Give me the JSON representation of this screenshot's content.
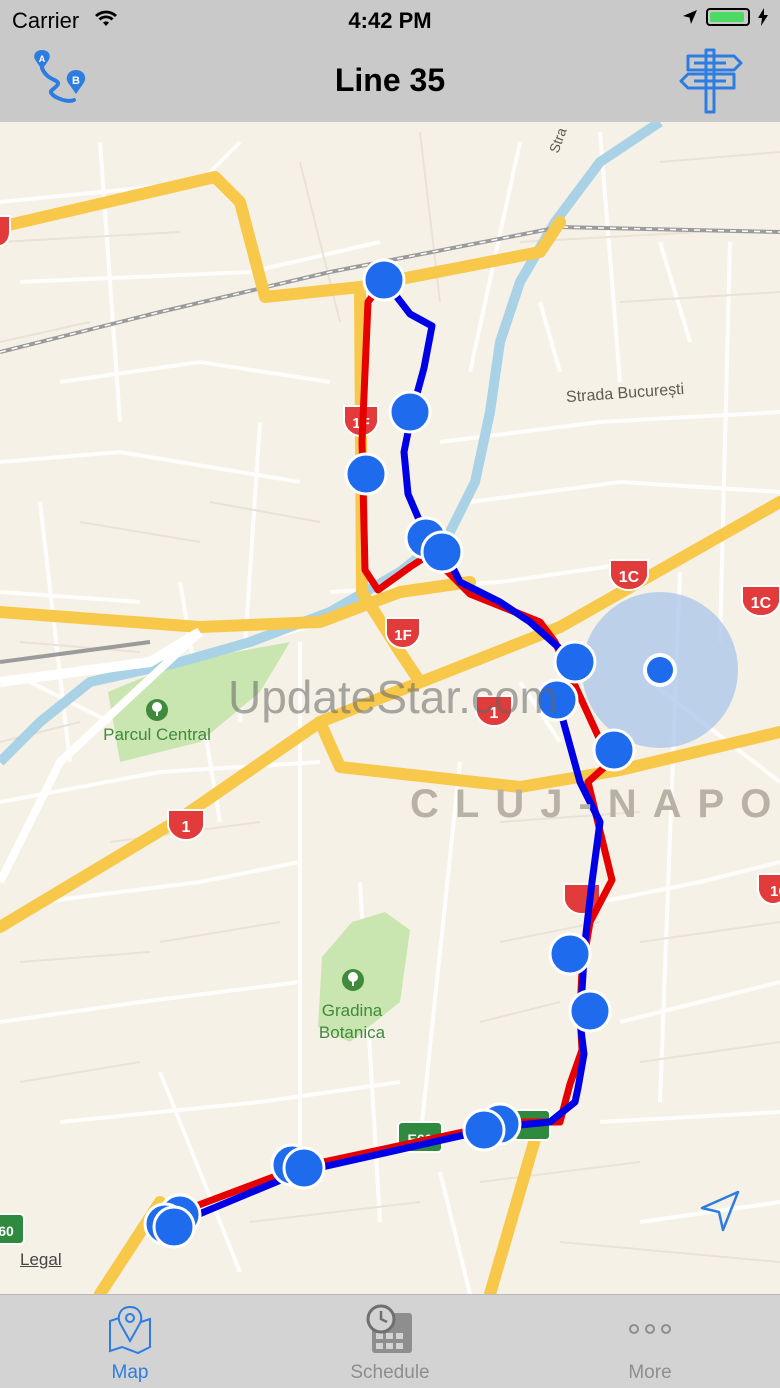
{
  "status_bar": {
    "carrier": "Carrier",
    "time": "4:42 PM"
  },
  "nav": {
    "title": "Line 35",
    "left_icon": "route-a-to-b-icon",
    "right_icon": "signpost-icon"
  },
  "map": {
    "watermark": "UpdateStar.com",
    "city_label": "CLUJ-NAPOC",
    "street_label": "Strada București",
    "park_1_name": "Parcul Central",
    "park_2_line1": "Gradina",
    "park_2_line2": "Botanica",
    "legal": "Legal",
    "road_shields": [
      "1F",
      "1F",
      "1F",
      "1C",
      "1C",
      "1",
      "1",
      "60"
    ],
    "route_colors": {
      "outbound": "#e60000",
      "inbound": "#0000e6",
      "stop": "#1f6bed"
    }
  },
  "tabs": [
    {
      "label": "Map",
      "icon": "map-pin-icon",
      "active": true
    },
    {
      "label": "Schedule",
      "icon": "schedule-icon",
      "active": false
    },
    {
      "label": "More",
      "icon": "more-dots-icon",
      "active": false
    }
  ],
  "colors": {
    "tab_active": "#2d7de1",
    "tab_inactive": "#8e8e8e"
  }
}
